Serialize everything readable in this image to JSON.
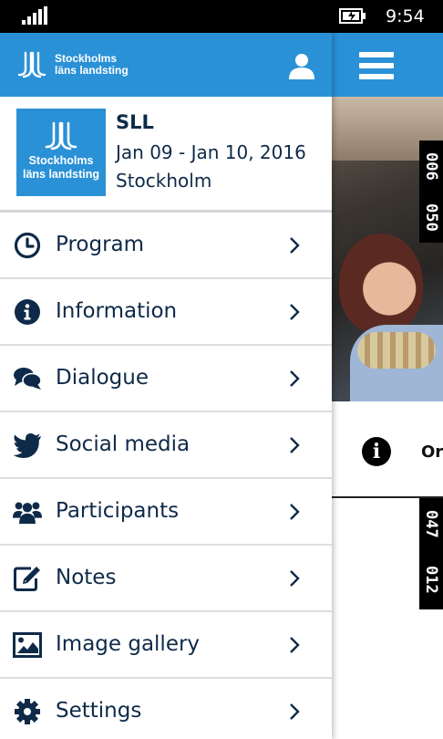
{
  "status_bar": {
    "time": "9:54"
  },
  "drawer": {
    "header": {
      "logo_line1": "Stockholms",
      "logo_line2": "läns landsting"
    },
    "event": {
      "logo_line1": "Stockholms",
      "logo_line2": "läns landsting",
      "name": "SLL",
      "dates": "Jan 09 - Jan 10, 2016",
      "location": "Stockholm"
    },
    "menu": [
      {
        "label": "Program",
        "icon": "clock-icon"
      },
      {
        "label": "Information",
        "icon": "info-icon"
      },
      {
        "label": "Dialogue",
        "icon": "chat-icon"
      },
      {
        "label": "Social media",
        "icon": "twitter-icon"
      },
      {
        "label": "Participants",
        "icon": "users-icon"
      },
      {
        "label": "Notes",
        "icon": "edit-icon"
      },
      {
        "label": "Image gallery",
        "icon": "image-icon"
      },
      {
        "label": "Settings",
        "icon": "gear-icon"
      }
    ]
  },
  "background": {
    "photo_tags": [
      "006",
      "050",
      "047",
      "012"
    ],
    "info_text": "Or"
  },
  "colors": {
    "brand_blue": "#2a91d6",
    "text_navy": "#0e2a48"
  }
}
